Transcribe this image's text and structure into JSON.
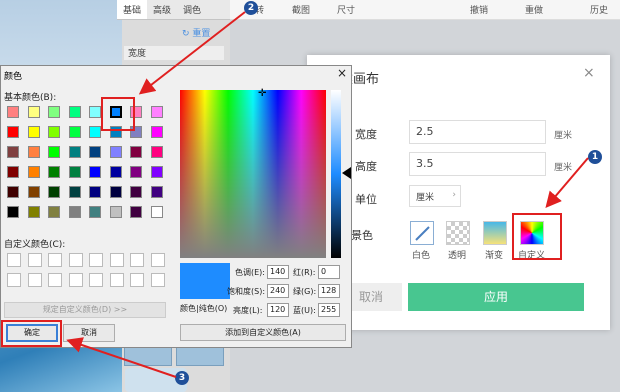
{
  "side_tabs": [
    "基础",
    "高级",
    "调色"
  ],
  "side": {
    "redo": "↻ 重置",
    "size_item": "宽度"
  },
  "toolbar": {
    "items": [
      "转",
      "截图",
      "尺寸",
      "撤销",
      "重做",
      "历史"
    ]
  },
  "canvas_modal": {
    "title": "建画布",
    "close": "×",
    "width_label": "宽度",
    "width_value": "2.5",
    "width_unit": "厘米",
    "height_label": "高度",
    "height_value": "3.5",
    "height_unit": "厘米",
    "unit_label": "单位",
    "unit_value": "厘米",
    "bg_label": "背景色",
    "bg_options": [
      "白色",
      "透明",
      "渐变",
      "自定义"
    ],
    "cancel": "取消",
    "apply": "应用"
  },
  "color_dialog": {
    "title": "颜色",
    "close": "×",
    "basic_label": "基本颜色(B):",
    "custom_label": "自定义颜色(C):",
    "define_button": "规定自定义颜色(D) >>",
    "ok": "确定",
    "cancel": "取消",
    "preview_label": "颜色|纯色(O)",
    "hue_label": "色调(E):",
    "hue": "140",
    "sat_label": "饱和度(S):",
    "sat": "240",
    "lum_label": "亮度(L):",
    "lum": "120",
    "red_label": "红(R):",
    "red": "0",
    "green_label": "绿(G):",
    "green": "128",
    "blue_label": "蓝(U):",
    "blue": "255",
    "add_custom": "添加到自定义颜色(A)",
    "basic_colors": [
      "#ff8080",
      "#ffff80",
      "#80ff80",
      "#00ff80",
      "#80ffff",
      "#0080ff",
      "#ff80c0",
      "#ff80ff",
      "#ff0000",
      "#ffff00",
      "#80ff00",
      "#00ff40",
      "#00ffff",
      "#0080c0",
      "#8080c0",
      "#ff00ff",
      "#804040",
      "#ff8040",
      "#00ff00",
      "#008080",
      "#004080",
      "#8080ff",
      "#800040",
      "#ff0080",
      "#800000",
      "#ff8000",
      "#008000",
      "#008040",
      "#0000ff",
      "#0000a0",
      "#800080",
      "#8000ff",
      "#400000",
      "#804000",
      "#004000",
      "#004040",
      "#000080",
      "#000040",
      "#400040",
      "#400080",
      "#000000",
      "#808000",
      "#808040",
      "#808080",
      "#408080",
      "#c0c0c0",
      "#400040",
      "#ffffff"
    ]
  },
  "badges": [
    "1",
    "2",
    "3"
  ]
}
